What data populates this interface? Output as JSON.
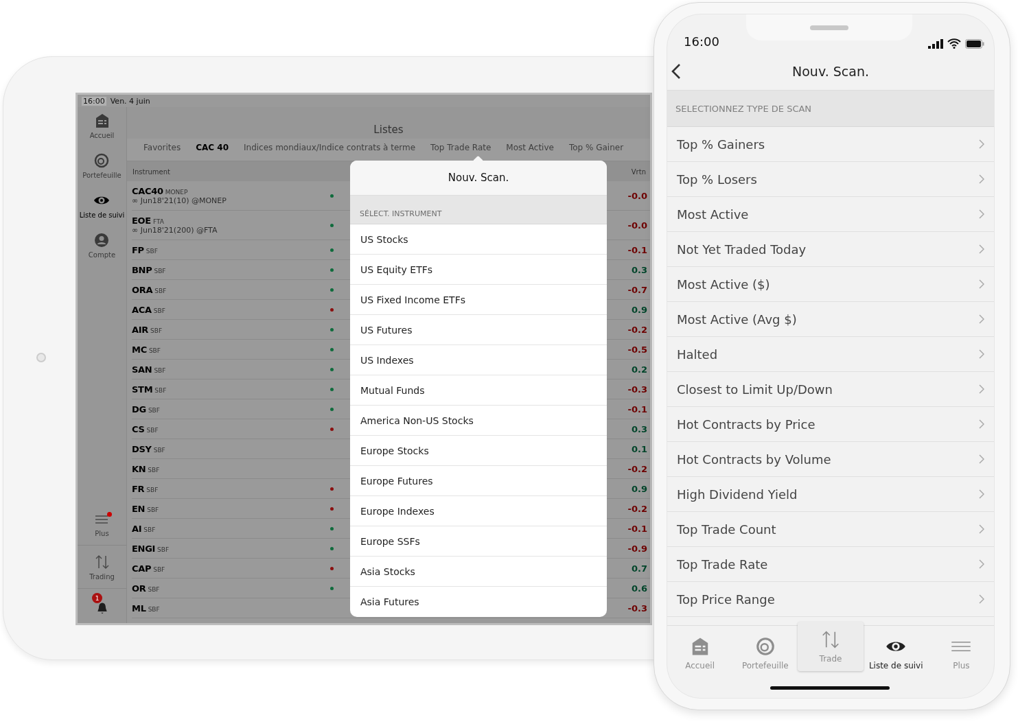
{
  "tablet": {
    "status_bar": {
      "time": "16:00",
      "date": "Ven. 4 juin"
    },
    "sidebar": {
      "items": [
        {
          "label": "Accueil",
          "selected": false
        },
        {
          "label": "Portefeuille",
          "selected": false
        },
        {
          "label": "Liste de suivi",
          "selected": true
        },
        {
          "label": "Compte",
          "selected": false
        }
      ],
      "bottom_items": [
        {
          "label": "Plus",
          "dot": true
        },
        {
          "label": "Trading",
          "dot": false
        }
      ],
      "alerts": {
        "badge": "1"
      }
    },
    "header": {
      "title": "Listes"
    },
    "tabs": [
      {
        "label": "Favorites",
        "selected": false
      },
      {
        "label": "CAC 40",
        "selected": true
      },
      {
        "label": "Indices mondiaux/Indice contrats à terme",
        "selected": false
      },
      {
        "label": "Top Trade Rate",
        "selected": false
      },
      {
        "label": "Most Active",
        "selected": false
      },
      {
        "label": "Top % Gainer",
        "selected": false
      }
    ],
    "table": {
      "columns": [
        "Instrument",
        "Vrtn"
      ],
      "rows": [
        {
          "symbol": "CAC40",
          "exchange": "MONEP",
          "contract": "∞ Jun18'21(10) @MONEP",
          "status": {
            "color": "#0f6b3c"
          },
          "change": {
            "text": "-0.0",
            "color": "#6e0000"
          }
        },
        {
          "symbol": "EOE",
          "exchange": "FTA",
          "contract": "∞ Jun18'21(200) @FTA",
          "status": {
            "color": "#0f6b3c"
          },
          "change": {
            "text": "-0.0",
            "color": "#6e0000"
          }
        },
        {
          "symbol": "FP",
          "exchange": "SBF",
          "status": {
            "color": "#0f6b3c"
          },
          "change": {
            "text": "-0.1",
            "color": "#6e0000"
          }
        },
        {
          "symbol": "BNP",
          "exchange": "SBF",
          "status": {
            "color": "#0f6b3c"
          },
          "change": {
            "text": "0.3",
            "color": "#00452a"
          }
        },
        {
          "symbol": "ORA",
          "exchange": "SBF",
          "status": {
            "color": "#0f6b3c"
          },
          "change": {
            "text": "-0.7",
            "color": "#6e0000"
          }
        },
        {
          "symbol": "ACA",
          "exchange": "SBF",
          "status": {
            "color": "#8a1010"
          },
          "change": {
            "text": "0.9",
            "color": "#00452a"
          }
        },
        {
          "symbol": "AIR",
          "exchange": "SBF",
          "status": {
            "color": "#0f6b3c"
          },
          "change": {
            "text": "-0.2",
            "color": "#6e0000"
          }
        },
        {
          "symbol": "MC",
          "exchange": "SBF",
          "status": {
            "color": "#0f6b3c"
          },
          "change": {
            "text": "-0.5",
            "color": "#6e0000"
          }
        },
        {
          "symbol": "SAN",
          "exchange": "SBF",
          "status": {
            "color": "#0f6b3c"
          },
          "change": {
            "text": "0.2",
            "color": "#00452a"
          }
        },
        {
          "symbol": "STM",
          "exchange": "SBF",
          "status": {
            "color": "#0f6b3c"
          },
          "change": {
            "text": "-0.3",
            "color": "#6e0000"
          }
        },
        {
          "symbol": "DG",
          "exchange": "SBF",
          "status": {
            "color": "#0f6b3c"
          },
          "change": {
            "text": "-0.1",
            "color": "#6e0000"
          }
        },
        {
          "symbol": "CS",
          "exchange": "SBF",
          "status": {
            "color": "#8a1010"
          },
          "change": {
            "text": "0.3",
            "color": "#00452a"
          }
        },
        {
          "symbol": "DSY",
          "exchange": "SBF",
          "change": {
            "text": "0.1",
            "color": "#00452a"
          }
        },
        {
          "symbol": "KN",
          "exchange": "SBF",
          "change": {
            "text": "-0.2",
            "color": "#6e0000"
          }
        },
        {
          "symbol": "FR",
          "exchange": "SBF",
          "status": {
            "color": "#8a1010"
          },
          "change": {
            "text": "0.9",
            "color": "#00452a"
          }
        },
        {
          "symbol": "EN",
          "exchange": "SBF",
          "status": {
            "color": "#8a1010"
          },
          "change": {
            "text": "-0.2",
            "color": "#6e0000"
          }
        },
        {
          "symbol": "AI",
          "exchange": "SBF",
          "status": {
            "color": "#0f6b3c"
          },
          "change": {
            "text": "-0.1",
            "color": "#6e0000"
          }
        },
        {
          "symbol": "ENGI",
          "exchange": "SBF",
          "status": {
            "color": "#0f6b3c"
          },
          "change": {
            "text": "-0.9",
            "color": "#6e0000"
          }
        },
        {
          "symbol": "CAP",
          "exchange": "SBF",
          "status": {
            "color": "#8a1010"
          },
          "change": {
            "text": "0.7",
            "color": "#00452a"
          }
        },
        {
          "symbol": "OR",
          "exchange": "SBF",
          "status": {
            "color": "#0f6b3c"
          },
          "change": {
            "text": "0.6",
            "color": "#00452a"
          }
        },
        {
          "symbol": "ML",
          "exchange": "SBF",
          "change": {
            "text": "-0.3",
            "color": "#6e0000"
          }
        }
      ]
    },
    "popover": {
      "title": "Nouv. Scan.",
      "section": "SÉLECT. INSTRUMENT",
      "items": [
        "US Stocks",
        "US Equity ETFs",
        "US Fixed Income ETFs",
        "US Futures",
        "US Indexes",
        "Mutual Funds",
        "America Non-US Stocks",
        "Europe Stocks",
        "Europe Futures",
        "Europe Indexes",
        "Europe SSFs",
        "Asia Stocks",
        "Asia Futures"
      ]
    }
  },
  "phone": {
    "status_bar": {
      "time": "16:00"
    },
    "nav": {
      "title": "Nouv. Scan."
    },
    "section": "SELECTIONNEZ TYPE DE SCAN",
    "items": [
      "Top % Gainers",
      "Top % Losers",
      "Most Active",
      "Not Yet Traded Today",
      "Most Active ($)",
      "Most Active (Avg $)",
      "Halted",
      "Closest to Limit Up/Down",
      "Hot Contracts by Price",
      "Hot Contracts by Volume",
      "High Dividend Yield",
      "Top Trade Count",
      "Top Trade Rate",
      "Top Price Range"
    ],
    "tab_bar": [
      {
        "label": "Accueil",
        "selected": false,
        "highlighted": false
      },
      {
        "label": "Portefeuille",
        "selected": false,
        "highlighted": false
      },
      {
        "label": "Trade",
        "selected": false,
        "highlighted": true
      },
      {
        "label": "Liste de suivi",
        "selected": true,
        "highlighted": false
      },
      {
        "label": "Plus",
        "selected": false,
        "highlighted": false
      }
    ]
  }
}
